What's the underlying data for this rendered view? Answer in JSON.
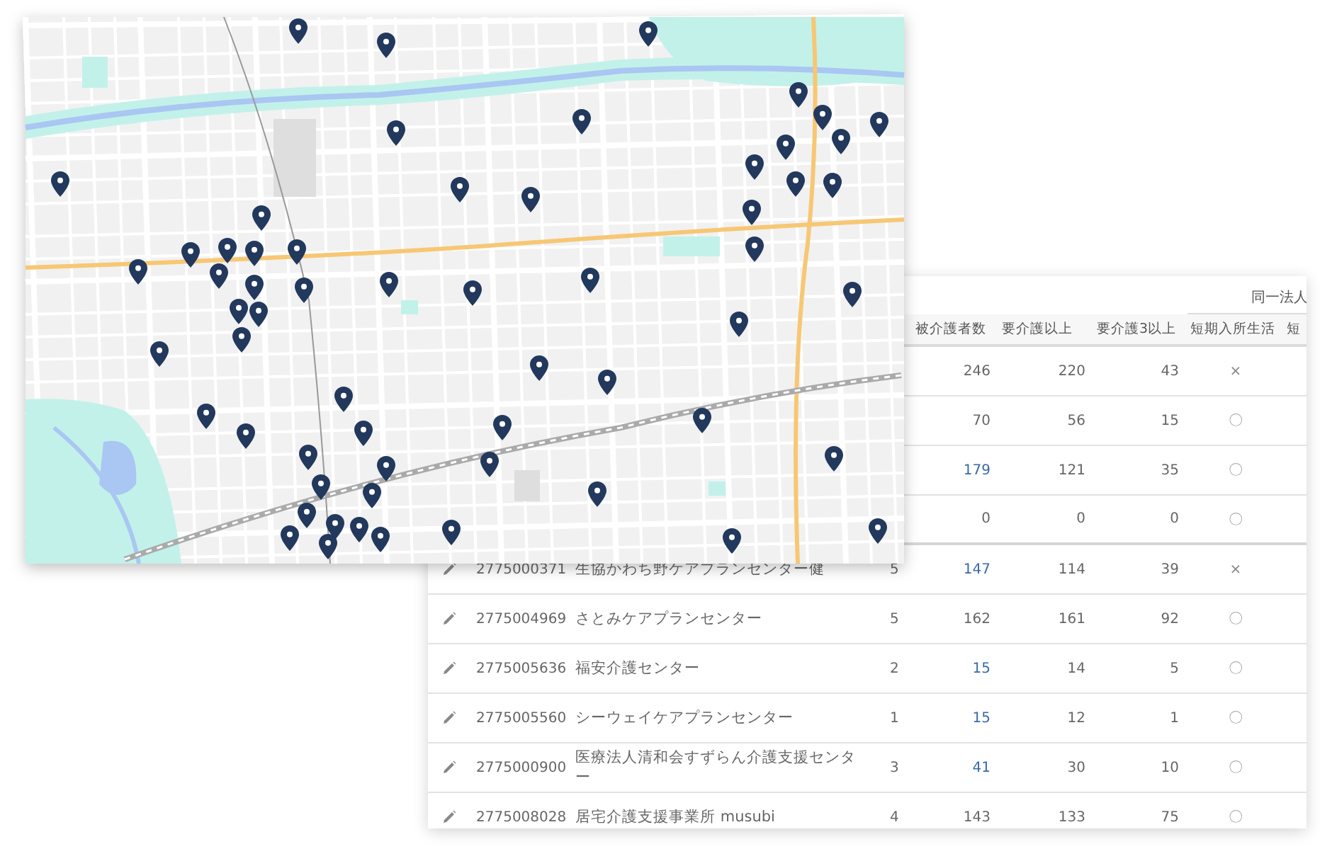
{
  "table": {
    "group_header": "同一法人",
    "columns": [
      "被介護者数",
      "要介護以上",
      "要介護3以上",
      "短期入所生活",
      "短"
    ],
    "rows": [
      {
        "care_recipients": "246",
        "care_recipients_link": false,
        "care_1_plus": "220",
        "care_3_plus": "43",
        "short_stay": "×"
      },
      {
        "care_recipients": "70",
        "care_recipients_link": false,
        "care_1_plus": "56",
        "care_3_plus": "15",
        "short_stay": "〇"
      },
      {
        "care_recipients": "179",
        "care_recipients_link": true,
        "care_1_plus": "121",
        "care_3_plus": "35",
        "short_stay": "〇"
      },
      {
        "care_recipients": "0",
        "care_recipients_link": false,
        "care_1_plus": "0",
        "care_3_plus": "0",
        "short_stay": "〇"
      },
      {
        "id": "2775000371",
        "name": "生協かわち野ケアプランセンター健",
        "count": "5",
        "care_recipients": "147",
        "care_recipients_link": true,
        "care_1_plus": "114",
        "care_3_plus": "39",
        "short_stay": "×"
      },
      {
        "id": "2775004969",
        "name": "さとみケアプランセンター",
        "count": "5",
        "care_recipients": "162",
        "care_recipients_link": false,
        "care_1_plus": "161",
        "care_3_plus": "92",
        "short_stay": "〇"
      },
      {
        "id": "2775005636",
        "name": "福安介護センター",
        "count": "2",
        "care_recipients": "15",
        "care_recipients_link": true,
        "care_1_plus": "14",
        "care_3_plus": "5",
        "short_stay": "〇"
      },
      {
        "id": "2775005560",
        "name": "シーウェイケアプランセンター",
        "count": "1",
        "care_recipients": "15",
        "care_recipients_link": true,
        "care_1_plus": "12",
        "care_3_plus": "1",
        "short_stay": "〇"
      },
      {
        "id": "2775000900",
        "name": "医療法人清和会すずらん介護支援センター",
        "count": "3",
        "care_recipients": "41",
        "care_recipients_link": true,
        "care_1_plus": "30",
        "care_3_plus": "10",
        "short_stay": "〇"
      },
      {
        "id": "2775008028",
        "name": "居宅介護支援事業所 musubi",
        "count": "4",
        "care_recipients": "143",
        "care_recipients_link": false,
        "care_1_plus": "133",
        "care_3_plus": "75",
        "short_stay": "〇"
      }
    ]
  }
}
